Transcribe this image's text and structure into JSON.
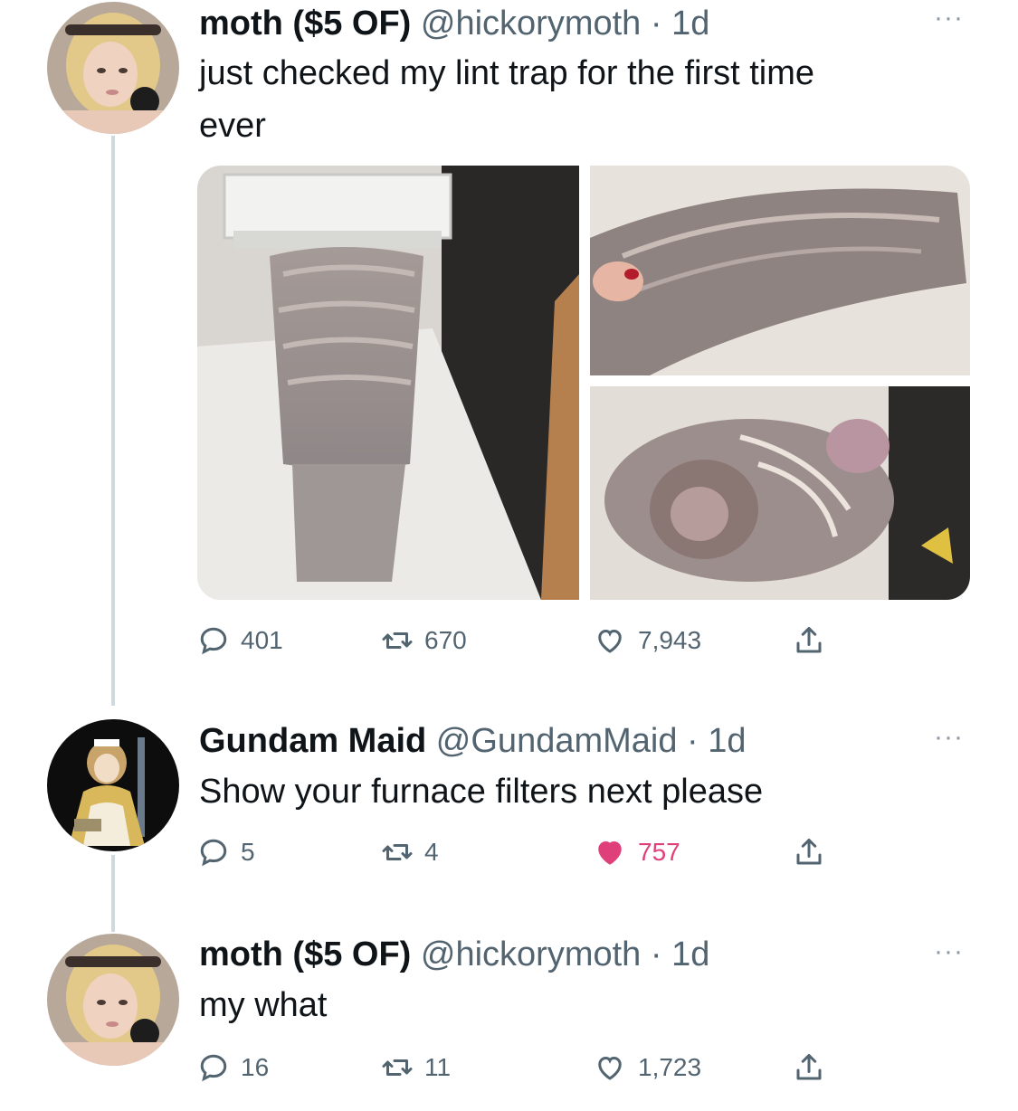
{
  "tweets": [
    {
      "name": "moth ($5 OF)",
      "handle": "@hickorymoth",
      "dot": "·",
      "time": "1d",
      "text_line1": "just checked my lint trap for the first time",
      "text_line2": "ever",
      "avatar": "user-avatar-blonde",
      "more": "···",
      "stats": {
        "replies": "401",
        "retweets": "670",
        "likes": "7,943",
        "liked": false
      }
    },
    {
      "name": "Gundam Maid",
      "handle": "@GundamMaid",
      "dot": "·",
      "time": "1d",
      "text_line1": "Show your furnace filters next please",
      "avatar": "anime-maid-avatar",
      "more": "···",
      "stats": {
        "replies": "5",
        "retweets": "4",
        "likes": "757",
        "liked": true
      }
    },
    {
      "name": "moth ($5 OF)",
      "handle": "@hickorymoth",
      "dot": "·",
      "time": "1d",
      "text_line1": "my what",
      "avatar": "user-avatar-blonde",
      "more": "···",
      "stats": {
        "replies": "16",
        "retweets": "11",
        "likes": "1,723",
        "liked": false
      }
    }
  ],
  "icons": {
    "reply": "comment-bubble-icon",
    "retweet": "retweet-arrows-icon",
    "like": "heart-icon",
    "share": "share-upload-icon"
  },
  "colors": {
    "text": "#0f1419",
    "muted": "#536471",
    "like_active": "#e0407a",
    "thread_line": "#cfd9de"
  }
}
